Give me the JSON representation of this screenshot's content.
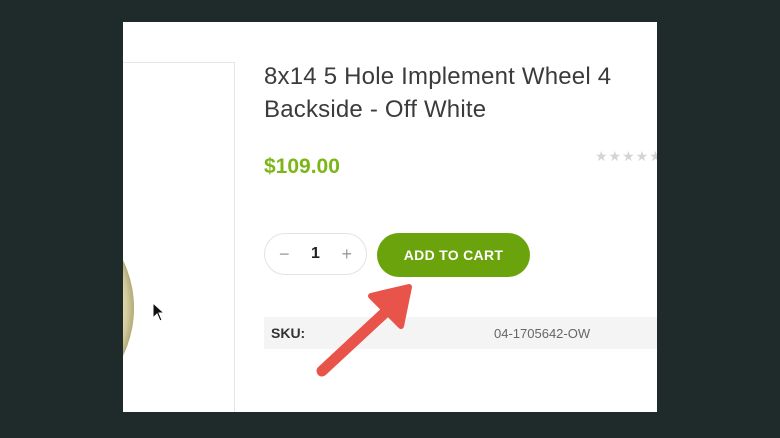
{
  "product": {
    "title_line1": "8x14 5 Hole Implement Wheel 4",
    "title_line2": "Backside - Off White",
    "price": "$109.00",
    "rating_stars": "★★★★★"
  },
  "cart": {
    "quantity": "1",
    "minus": "−",
    "plus": "+",
    "add_label": "ADD TO CART"
  },
  "meta": {
    "sku_label": "SKU:",
    "sku_value": "04-1705642-OW"
  },
  "colors": {
    "accent": "#6aa30b",
    "price": "#7cb518",
    "annotation_arrow": "#e8534a"
  },
  "annotation": {
    "icon": "red-arrow-icon"
  }
}
